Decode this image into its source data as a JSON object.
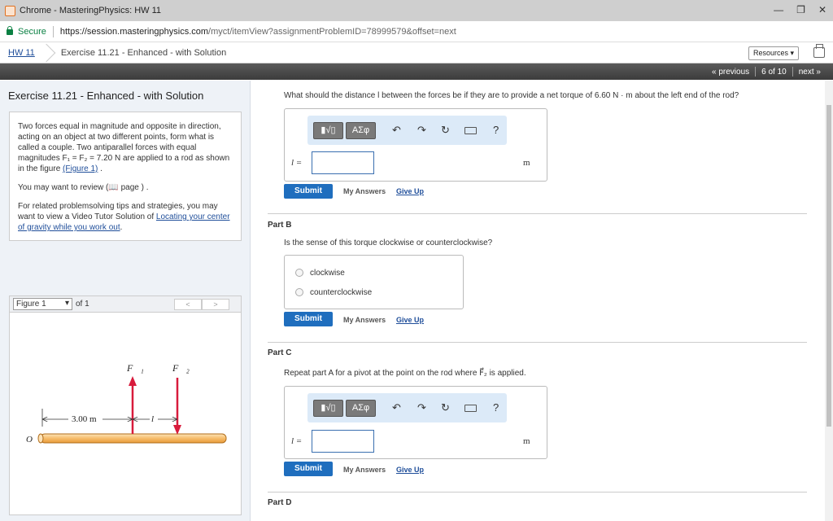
{
  "window": {
    "title": "Chrome - MasteringPhysics: HW 11",
    "min_icon": "minimize-icon",
    "max_icon": "maximize-icon",
    "close_icon": "close-icon"
  },
  "address": {
    "secure_label": "Secure",
    "url_host": "https://session.masteringphysics.com",
    "url_path": "/myct/itemView?assignmentProblemID=78999579&offset=next"
  },
  "breadcrumb": {
    "hw": "HW 11",
    "exercise": "Exercise 11.21 - Enhanced - with Solution",
    "resources": "Resources ▾"
  },
  "nav": {
    "previous": "« previous",
    "position": "6 of 10",
    "next": "next »"
  },
  "left": {
    "heading": "Exercise 11.21 - Enhanced - with Solution",
    "intro_p1": "Two forces equal in magnitude and opposite in direction, acting on an object at two different points, form what is called a couple. Two antiparallel forces with equal magnitudes F₁ = F₂ = 7.20 N are applied to a rod as shown in the figure",
    "figure_link": "(Figure 1)",
    "intro_p2": "You may want to review (📖 page ) .",
    "intro_p3": "For related problemsolving tips and strategies, you may want to view a Video Tutor Solution of",
    "video_link": "Locating your center of gravity while you work out",
    "figure_select": "Figure 1",
    "figure_of": "of 1",
    "pager_prev": "<",
    "pager_next": ">"
  },
  "figure": {
    "f1": "F⃗₁",
    "f2": "F⃗₂",
    "dist": "3.00 m",
    "l": "l",
    "origin": "O"
  },
  "partA": {
    "question": "What should the distance l between the forces be if they are to provide a net torque of 6.60 N · m about the left end of the rod?",
    "toolbar_tmpl": "▮√▯",
    "toolbar_greek": "ΑΣφ",
    "help": "?",
    "var": "l =",
    "unit": "m",
    "submit": "Submit",
    "my_answers": "My Answers",
    "give_up": "Give Up"
  },
  "partB": {
    "label": "Part B",
    "question": "Is the sense of this torque clockwise or counterclockwise?",
    "options": [
      "clockwise",
      "counterclockwise"
    ],
    "submit": "Submit",
    "my_answers": "My Answers",
    "give_up": "Give Up"
  },
  "partC": {
    "label": "Part C",
    "question": "Repeat part A for a pivot at the point on the rod where F⃗₂ is applied.",
    "toolbar_tmpl": "▮√▯",
    "toolbar_greek": "ΑΣφ",
    "help": "?",
    "var": "l =",
    "unit": "m",
    "submit": "Submit",
    "my_answers": "My Answers",
    "give_up": "Give Up"
  },
  "partD": {
    "label": "Part D"
  }
}
